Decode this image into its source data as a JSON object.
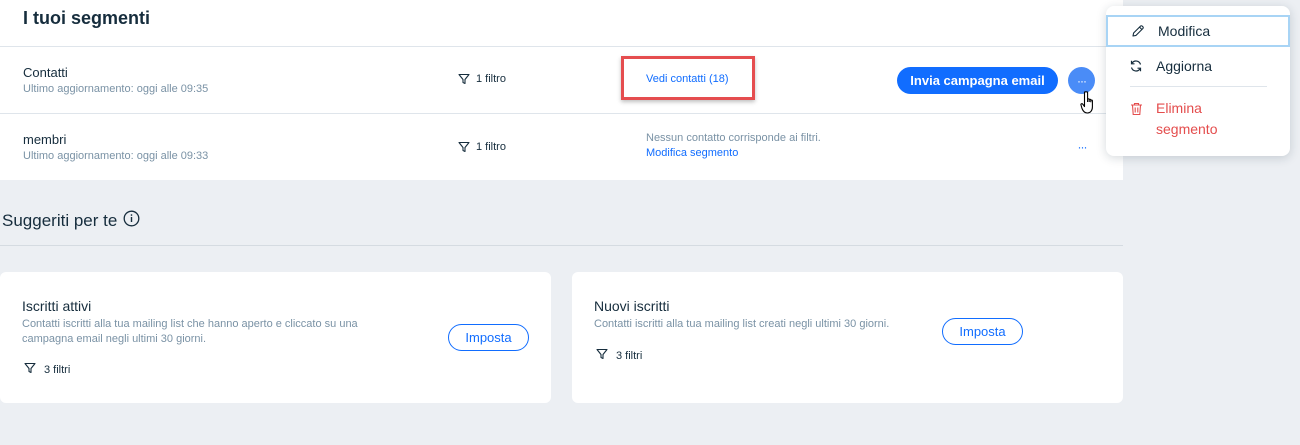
{
  "segments_panel": {
    "title": "I tuoi segmenti",
    "rows": [
      {
        "name": "Contatti",
        "updated": "Ultimo aggiornamento: oggi alle 09:35",
        "filters": "1 filtro",
        "view_link": "Vedi contatti (18)",
        "send_button": "Invia campagna email",
        "more": "···"
      },
      {
        "name": "membri",
        "updated": "Ultimo aggiornamento: oggi alle 09:33",
        "filters": "1 filtro",
        "status": "Nessun contatto corrisponde ai filtri.",
        "edit_link": "Modifica segmento",
        "more": "···"
      }
    ]
  },
  "suggestions": {
    "title": "Suggeriti per te",
    "cards": [
      {
        "title": "Iscritti attivi",
        "description_line1": "Contatti iscritti alla tua mailing list che hanno aperto e cliccato su una",
        "description_line2": "campagna email negli ultimi 30 giorni.",
        "filters": "3 filtri",
        "button": "Imposta"
      },
      {
        "title": "Nuovi iscritti",
        "description_line1": "Contatti iscritti alla tua mailing list creati negli ultimi 30 giorni.",
        "filters": "3 filtri",
        "button": "Imposta"
      }
    ]
  },
  "context_menu": {
    "items": [
      {
        "label": "Modifica",
        "icon": "pencil-icon"
      },
      {
        "label": "Aggiorna",
        "icon": "refresh-icon"
      },
      {
        "label_line1": "Elimina",
        "label_line2": "segmento",
        "icon": "trash-icon"
      }
    ]
  },
  "colors": {
    "accent": "#116dff",
    "danger": "#e44d4d",
    "highlight": "#e54d4f",
    "background": "#eceff3"
  }
}
